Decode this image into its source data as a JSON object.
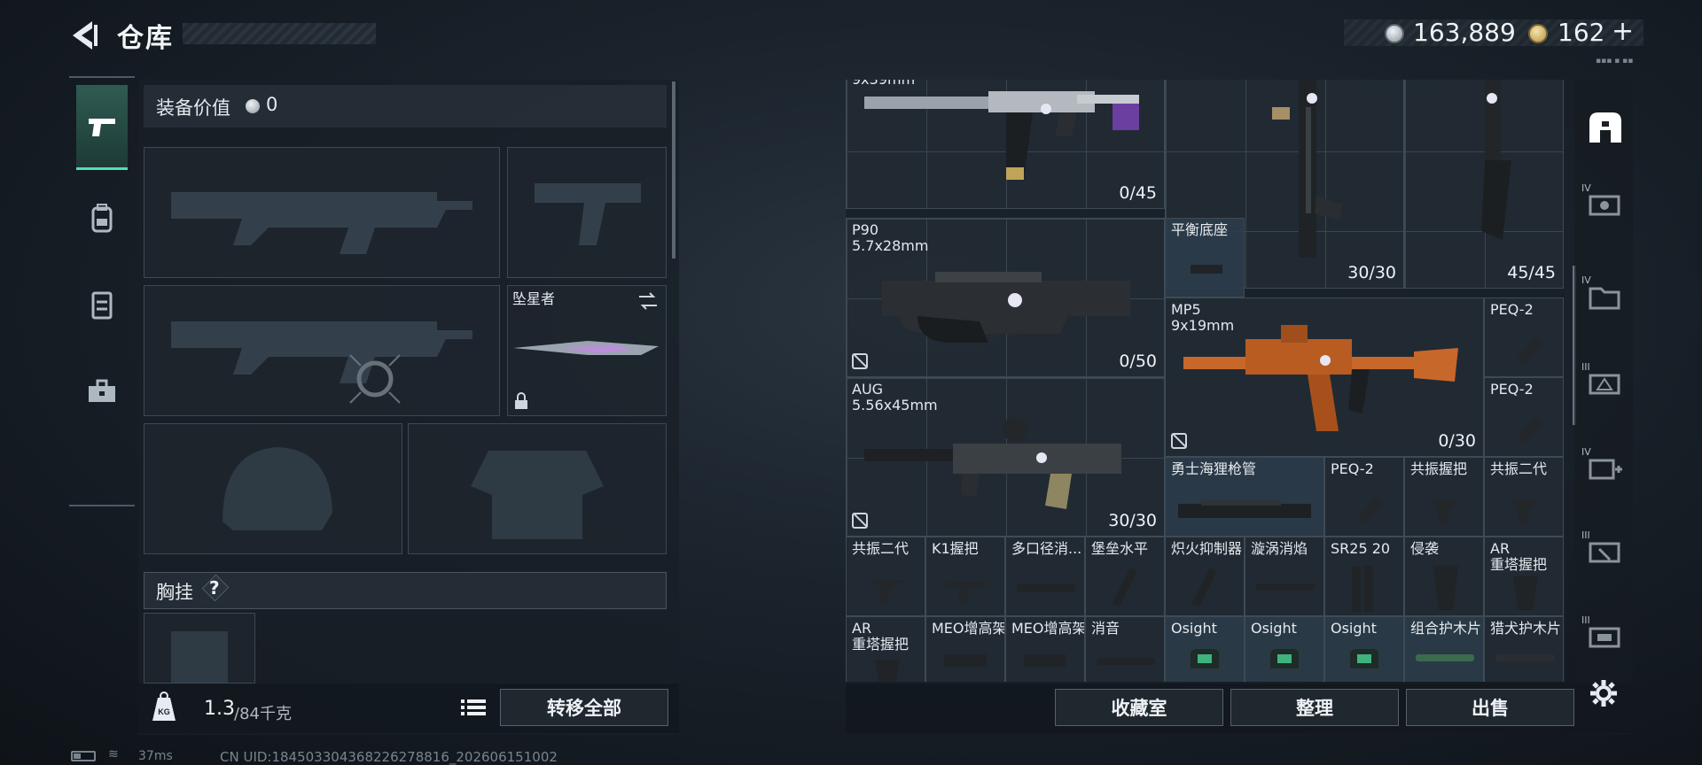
{
  "header": {
    "title": "仓库"
  },
  "currency": {
    "coins": "163,889",
    "tokens": "162",
    "plus_label": "+",
    "tiny_id": "▪▪▪ ▪ ▪▪"
  },
  "loadout": {
    "equip_value_label": "装备价值",
    "equip_value": "0",
    "knife_name": "坠星者",
    "chest_label": "胸挂",
    "chest_help": "?"
  },
  "weight": {
    "current": "1.3",
    "max": "/84千克",
    "kg_icon_text": "KG"
  },
  "buttons": {
    "transfer_all": "转移全部",
    "collection_room": "收藏室",
    "organize": "整理",
    "sell": "出售"
  },
  "status": {
    "ping": "37ms",
    "uid": "CN UID:1845033043682262788​16_202606151002"
  },
  "items": [
    {
      "name": "9x39mm",
      "count": "0/45",
      "icon": "rifle-icon"
    },
    {
      "name": "",
      "count": "30/30",
      "icon": "sniper-icon"
    },
    {
      "name": "",
      "count": "45/45",
      "icon": "rifle-stock-icon"
    },
    {
      "name": "P90\n5.7x28mm",
      "count": "0/50",
      "icon": "smg-p90-icon"
    },
    {
      "name": "平衡底座",
      "count": "",
      "icon": "mount-icon"
    },
    {
      "name": "MP5\n9x19mm",
      "count": "0/30",
      "icon": "smg-mp5-icon"
    },
    {
      "name": "PEQ-2",
      "count": "",
      "icon": "laser-icon"
    },
    {
      "name": "PEQ-2",
      "count": "",
      "icon": "laser-icon"
    },
    {
      "name": "AUG\n5.56x45mm",
      "count": "30/30",
      "icon": "rifle-aug-icon"
    },
    {
      "name": "勇士海狸枪管",
      "count": "",
      "icon": "barrel-icon"
    },
    {
      "name": "PEQ-2",
      "count": "",
      "icon": "laser-icon"
    },
    {
      "name": "共振握把",
      "count": "",
      "icon": "grip-icon"
    },
    {
      "name": "共振二代",
      "count": "",
      "icon": "grip-icon"
    },
    {
      "name": "共振二代",
      "count": "",
      "icon": "grip-icon"
    },
    {
      "name": "K1握把",
      "count": "",
      "icon": "grip-icon"
    },
    {
      "name": "多口径消...",
      "count": "",
      "icon": "suppressor-icon"
    },
    {
      "name": "堡垒水平",
      "count": "",
      "icon": "grip-icon"
    },
    {
      "name": "炽火抑制器",
      "count": "",
      "icon": "suppressor-icon"
    },
    {
      "name": "漩涡消焰",
      "count": "",
      "icon": "suppressor-icon"
    },
    {
      "name": "SR25 20",
      "count": "",
      "icon": "magazine-icon"
    },
    {
      "name": "侵袭",
      "count": "",
      "icon": "pistol-grip-icon"
    },
    {
      "name": "AR\n重塔握把",
      "count": "",
      "icon": "pistol-grip-icon"
    },
    {
      "name": "AR\n重塔握把",
      "count": "",
      "icon": "pistol-grip-icon"
    },
    {
      "name": "MEO增高架",
      "count": "",
      "icon": "riser-icon"
    },
    {
      "name": "MEO增高架",
      "count": "",
      "icon": "riser-icon"
    },
    {
      "name": "消音",
      "count": "",
      "icon": "suppressor-icon"
    },
    {
      "name": "Osight",
      "count": "",
      "icon": "sight-icon"
    },
    {
      "name": "Osight",
      "count": "",
      "icon": "sight-icon"
    },
    {
      "name": "Osight",
      "count": "",
      "icon": "sight-icon"
    },
    {
      "name": "组合护木片",
      "count": "",
      "icon": "handguard-icon"
    },
    {
      "name": "猎犬护木片",
      "count": "",
      "icon": "handguard-icon"
    }
  ],
  "categories": [
    {
      "tier": "",
      "icon": "all-items-icon"
    },
    {
      "tier": "IV",
      "icon": "weapon-case-icon"
    },
    {
      "tier": "IV",
      "icon": "folder-case-icon"
    },
    {
      "tier": "III",
      "icon": "ammo-case-icon"
    },
    {
      "tier": "IV",
      "icon": "medical-case-icon"
    },
    {
      "tier": "III",
      "icon": "tool-case-icon"
    },
    {
      "tier": "III",
      "icon": "misc-case-icon"
    }
  ],
  "colors": {
    "accent": "#4fe0b5",
    "panel": "#1f272f",
    "copper": "#c8672a",
    "teal_highlight": "#2c3c4a"
  }
}
